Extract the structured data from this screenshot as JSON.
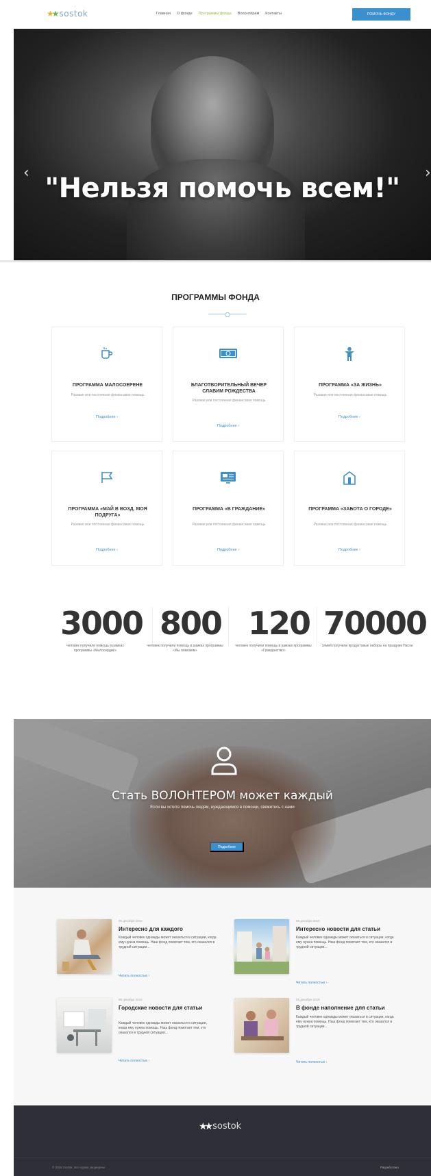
{
  "header": {
    "logo_text": "sostok",
    "nav": [
      "Главная",
      "О фонде",
      "Программы фонда",
      "Волонтёрам",
      "Контакты"
    ],
    "active_nav": "Программы фонда",
    "help_button": "ПОМОЧЬ ФОНДУ"
  },
  "hero": {
    "title": "\"Нельзя помочь всем!\""
  },
  "programs": {
    "title": "ПРОГРАММЫ ФОНДА",
    "cards": [
      {
        "icon": "cup-icon",
        "title": "ПРОГРАММА МАЛОСОЕРЕНЕ",
        "desc": "Разовая или постоянная финансовая помощь",
        "link": "Подробнее ›"
      },
      {
        "icon": "money-icon",
        "title": "БЛАГОТВОРИТЕЛЬНЫЙ ВЕЧЕР СЛАВИМ РОЖДЕСТВА",
        "desc": "Разовая или постоянная финансовая помощь",
        "link": "Подробнее ›"
      },
      {
        "icon": "person-icon",
        "title": "ПРОГРАММА «ЗА ЖИЗНЬ»",
        "desc": "Разовая или постоянная финансовая помощь",
        "link": "Подробнее ›"
      },
      {
        "icon": "flag-icon",
        "title": "ПРОГРАММА «МАЙ В ВОЗД. МОЯ ПОДРУГА»",
        "desc": "Разовая или постоянная финансовая помощь",
        "link": "Подробнее ›"
      },
      {
        "icon": "monitor-icon",
        "title": "ПРОГРАММА «В ГРАЖДАНИЕ»",
        "desc": "Разовая или постоянная финансовая помощь",
        "link": "Подробнее ›"
      },
      {
        "icon": "house-icon",
        "title": "ПРОГРАММА «ЗАБОТА О ГОРОДЕ»",
        "desc": "Разовая или постоянная финансовая помощь",
        "link": "Подробнее ›"
      }
    ]
  },
  "stats": [
    {
      "number": "3000",
      "label": "человек получили помощь в рамках программы «Милосердие»"
    },
    {
      "number": "800",
      "label": "человек получили помощь в рамках программы «Мы поможем»"
    },
    {
      "number": "120",
      "label": "человек получили помощь в рамках программы «Гражданство»"
    },
    {
      "number": "70000",
      "label": "семей получили продуктовые наборы на праздник Пасхи"
    }
  ],
  "volunteer": {
    "title": "Стать ВОЛОНТЕРОМ может каждый",
    "subtitle": "Если вы хотите помочь людям, нуждающимся в помощи, свяжитесь с нами",
    "button": "Подробнее"
  },
  "news": [
    {
      "date": "08 декабря 2016",
      "title": "Интересно для каждого",
      "text": "Каждый человек однажды может оказаться в ситуации, когда ему нужна помощь. Наш фонд помогает тем, кто оказался в трудной ситуации...",
      "link": "Читать полностью ›"
    },
    {
      "date": "08 декабря 2016",
      "title": "Городские новости для статьи",
      "text": "Каждый человек однажды может оказаться в ситуации, когда ему нужна помощь. Наш фонд помогает тем, кто оказался в трудной ситуации...",
      "link": "Читать полностью ›"
    },
    {
      "date": "08 декабря 2016",
      "title": "Интересно новости для статьи",
      "text": "Каждый человек однажды может оказаться в ситуации, когда ему нужна помощь. Наш фонд помогает тем, кто оказался в трудной ситуации...",
      "link": "Читать полностью ›"
    },
    {
      "date": "08 декабря 2016",
      "title": "В фонде наполнение для статьи",
      "text": "Каждый человек однажды может оказаться в ситуации, когда ему нужна помощь. Наш фонд помогает тем, кто оказался в трудной ситуации...",
      "link": "Читать полностью ›"
    }
  ],
  "footer": {
    "logo_text": "sostok",
    "copyright": "© 2016 Sostok. Все права защищены",
    "developer": "Разработано"
  }
}
